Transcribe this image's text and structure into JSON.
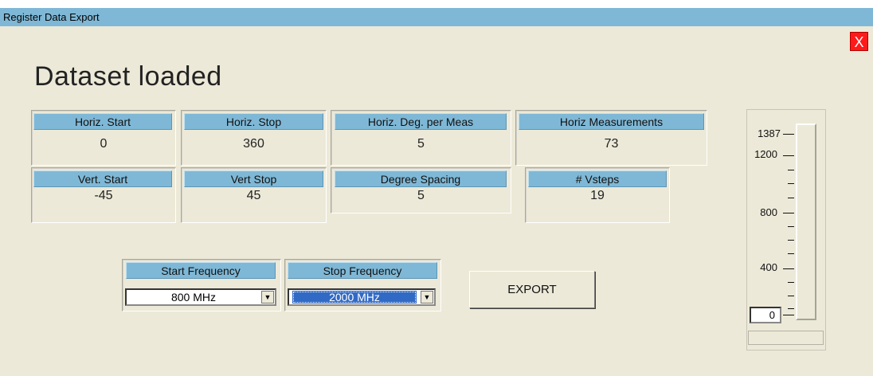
{
  "window": {
    "title": "Register Data Export",
    "close_label": "X"
  },
  "status_text": "Dataset loaded",
  "fields": {
    "horiz_start": {
      "label": "Horiz. Start",
      "value": "0"
    },
    "horiz_stop": {
      "label": "Horiz. Stop",
      "value": "360"
    },
    "horiz_deg_per_meas": {
      "label": "Horiz. Deg. per Meas",
      "value": "5"
    },
    "horiz_measurements": {
      "label": "Horiz Measurements",
      "value": "73"
    },
    "vert_start": {
      "label": "Vert. Start",
      "value": "-45"
    },
    "vert_stop": {
      "label": "Vert Stop",
      "value": "45"
    },
    "degree_spacing": {
      "label": "Degree Spacing",
      "value": "5"
    },
    "vsteps": {
      "label": "# Vsteps",
      "value": "19"
    }
  },
  "frequency": {
    "start": {
      "label": "Start Frequency",
      "selected": "800 MHz"
    },
    "stop": {
      "label": "Stop Frequency",
      "selected": "2000 MHz"
    }
  },
  "export_label": "EXPORT",
  "slider": {
    "labels": {
      "max": "1387",
      "l1200": "1200",
      "l800": "800",
      "l400": "400"
    },
    "value": "0",
    "level_fraction": 0
  }
}
